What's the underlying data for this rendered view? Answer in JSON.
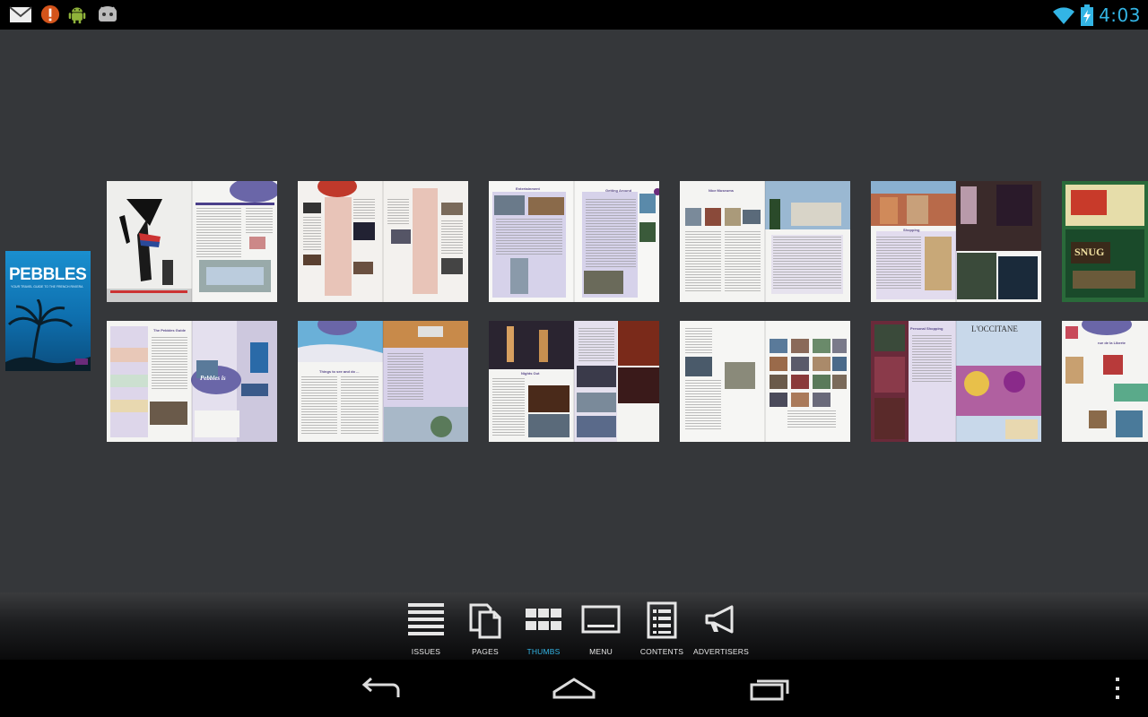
{
  "status_bar": {
    "time": "4:03",
    "notifications": [
      "gmail-icon",
      "alert-icon",
      "android-icon",
      "game-controller-icon"
    ],
    "system_icons": [
      "wifi-icon",
      "battery-charging-icon"
    ],
    "clock_color": "#33b5e5"
  },
  "cover": {
    "title": "PEBBLES",
    "subtitle": "YOUR TRAVEL GUIDE TO THE FRENCH RIVIERA"
  },
  "thumbnail_spreads": {
    "row1": [
      "editors-letter",
      "whats-on",
      "entertainment-getting-around",
      "nice-museums",
      "shopping",
      "snug"
    ],
    "row2": [
      "guide-contents",
      "pebbles-is-proud-to",
      "things-to-see-and-do",
      "nights-out",
      "libra-market",
      "personal-shopping-loccitane",
      "rue-de-la-liberte"
    ]
  },
  "toolbar": {
    "items": [
      {
        "label": "ISSUES",
        "icon": "list-lines-icon"
      },
      {
        "label": "PAGES",
        "icon": "pages-icon"
      },
      {
        "label": "THUMBS",
        "icon": "grid-icon"
      },
      {
        "label": "MENU",
        "icon": "menu-screen-icon"
      },
      {
        "label": "CONTENTS",
        "icon": "contents-document-icon"
      },
      {
        "label": "ADVERTISERS",
        "icon": "megaphone-icon"
      }
    ],
    "active": "THUMBS",
    "active_color": "#33b5e5"
  },
  "navbar": {
    "buttons": [
      "back-icon",
      "home-icon",
      "recent-apps-icon",
      "overflow-menu-icon"
    ]
  }
}
